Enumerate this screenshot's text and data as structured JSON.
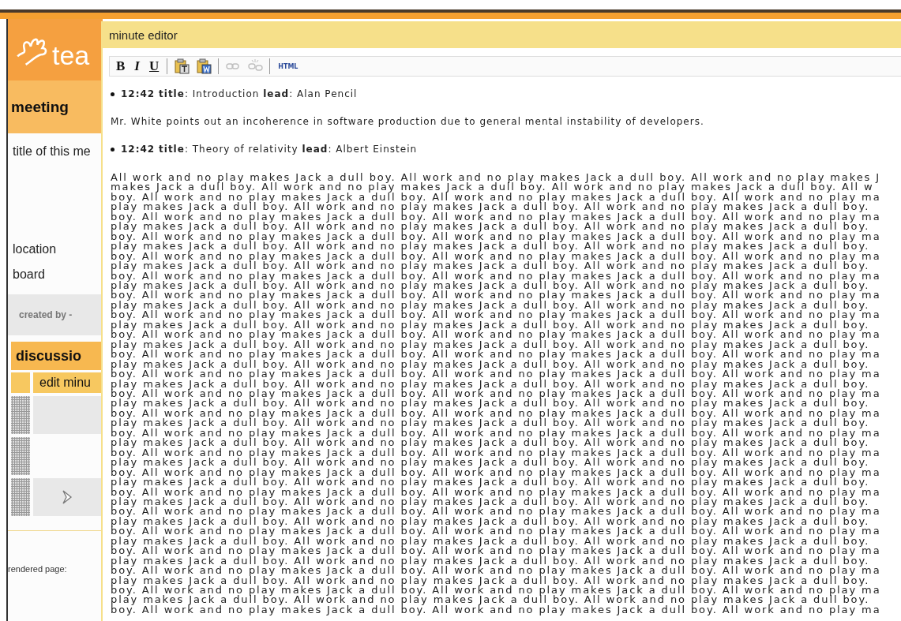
{
  "page": {
    "logo_text": "tea",
    "section_title": "meeting",
    "fields": [
      "title of this me",
      "location",
      "board"
    ],
    "created_by": "created by -",
    "discussion_title": "discussio",
    "column_header": "edit minu",
    "rows": [
      {
        "kind": "empty"
      },
      {
        "kind": "empty"
      },
      {
        "kind": "chevron"
      }
    ],
    "footer": "rendered page:"
  },
  "dialog": {
    "title": "minute editor",
    "toolbar": [
      {
        "kind": "bold",
        "label": "B",
        "disabled": false
      },
      {
        "kind": "italic",
        "label": "I",
        "disabled": false
      },
      {
        "kind": "underline",
        "label": "U",
        "disabled": false
      },
      {
        "kind": "separator"
      },
      {
        "kind": "paste-text",
        "disabled": false
      },
      {
        "kind": "paste-word",
        "disabled": false
      },
      {
        "kind": "separator"
      },
      {
        "kind": "link",
        "disabled": true
      },
      {
        "kind": "unlink",
        "disabled": true
      },
      {
        "kind": "separator"
      },
      {
        "kind": "html",
        "label": "HTML",
        "disabled": false
      }
    ],
    "entries": [
      {
        "kind": "item",
        "text": "**12:42** **title**: Introduction **lead**: Alan Pencil"
      },
      {
        "kind": "paragraph",
        "text": "Mr. White points out an incoherence in software production due to general mental instability of developers."
      },
      {
        "kind": "item",
        "text": "**12:42** **title**: Theory of relativity **lead**: Albert Einstein"
      }
    ],
    "body_lines": [
      "All work and no play makes Jack a dull boy. All work and no play makes Jack a dull boy. All work and no play makes J",
      "makes Jack a dull boy. All work and no play makes Jack a dull boy. All work and no play makes Jack a dull boy. All w",
      "boy. All work and no play makes Jack a dull boy. All work and no play makes Jack a dull boy. All work and no play ma",
      "play makes Jack a dull boy. All work and no play makes Jack a dull boy. All work and no play makes Jack a dull boy.",
      "boy. All work and no play makes Jack a dull boy. All work and no play makes Jack a dull boy. All work and no play ma",
      "play makes Jack a dull boy. All work and no play makes Jack a dull boy. All work and no play makes Jack a dull boy.",
      "boy. All work and no play makes Jack a dull boy. All work and no play makes Jack a dull boy. All work and no play ma",
      "play makes Jack a dull boy. All work and no play makes Jack a dull boy. All work and no play makes Jack a dull boy.",
      "boy. All work and no play makes Jack a dull boy. All work and no play makes Jack a dull boy. All work and no play ma",
      "play makes Jack a dull boy. All work and no play makes Jack a dull boy. All work and no play makes Jack a dull boy.",
      "boy. All work and no play makes Jack a dull boy. All work and no play makes Jack a dull boy. All work and no play ma",
      "play makes Jack a dull boy. All work and no play makes Jack a dull boy. All work and no play makes Jack a dull boy.",
      "boy. All work and no play makes Jack a dull boy. All work and no play makes Jack a dull boy. All work and no play ma",
      "play makes Jack a dull boy. All work and no play makes Jack a dull boy. All work and no play makes Jack a dull boy.",
      "boy. All work and no play makes Jack a dull boy. All work and no play makes Jack a dull boy. All work and no play ma",
      "play makes Jack a dull boy. All work and no play makes Jack a dull boy. All work and no play makes Jack a dull boy.",
      "boy. All work and no play makes Jack a dull boy. All work and no play makes Jack a dull boy. All work and no play ma",
      "play makes Jack a dull boy. All work and no play makes Jack a dull boy. All work and no play makes Jack a dull boy.",
      "boy. All work and no play makes Jack a dull boy. All work and no play makes Jack a dull boy. All work and no play ma",
      "play makes Jack a dull boy. All work and no play makes Jack a dull boy. All work and no play makes Jack a dull boy.",
      "boy. All work and no play makes Jack a dull boy. All work and no play makes Jack a dull boy. All work and no play ma",
      "play makes Jack a dull boy. All work and no play makes Jack a dull boy. All work and no play makes Jack a dull boy.",
      "boy. All work and no play makes Jack a dull boy. All work and no play makes Jack a dull boy. All work and no play ma",
      "play makes Jack a dull boy. All work and no play makes Jack a dull boy. All work and no play makes Jack a dull boy.",
      "boy. All work and no play makes Jack a dull boy. All work and no play makes Jack a dull boy. All work and no play ma",
      "play makes Jack a dull boy. All work and no play makes Jack a dull boy. All work and no play makes Jack a dull boy.",
      "boy. All work and no play makes Jack a dull boy. All work and no play makes Jack a dull boy. All work and no play ma",
      "play makes Jack a dull boy. All work and no play makes Jack a dull boy. All work and no play makes Jack a dull boy.",
      "boy. All work and no play makes Jack a dull boy. All work and no play makes Jack a dull boy. All work and no play ma",
      "play makes Jack a dull boy. All work and no play makes Jack a dull boy. All work and no play makes Jack a dull boy.",
      "boy. All work and no play makes Jack a dull boy. All work and no play makes Jack a dull boy. All work and no play ma",
      "play makes Jack a dull boy. All work and no play makes Jack a dull boy. All work and no play makes Jack a dull boy.",
      "boy. All work and no play makes Jack a dull boy. All work and no play makes Jack a dull boy. All work and no play ma",
      "play makes Jack a dull boy. All work and no play makes Jack a dull boy. All work and no play makes Jack a dull boy.",
      "boy. All work and no play makes Jack a dull boy. All work and no play makes Jack a dull boy. All work and no play ma",
      "play makes Jack a dull boy. All work and no play makes Jack a dull boy. All work and no play makes Jack a dull boy.",
      "boy. All work and no play makes Jack a dull boy. All work and no play makes Jack a dull boy. All work and no play ma",
      "play makes Jack a dull boy. All work and no play makes Jack a dull boy. All work and no play makes Jack a dull boy.",
      "boy. All work and no play makes Jack a dull boy. All work and no play makes Jack a dull boy. All work and no play ma",
      "play makes Jack a dull boy. All work and no play makes Jack a dull boy. All work and no play makes Jack a dull boy.",
      "boy. All work and no play makes Jack a dull boy. All work and no play makes Jack a dull boy. All work and no play ma",
      "play makes Jack a dull boy. All work and no play makes Jack a dull boy. All work and no play makes Jack a dull boy.",
      "boy. All work and no play makes Jack a dull boy. All work and no play makes Jack a dull boy. All work and no play ma",
      "play makes Jack a dull boy. All work and no play makes Jack a dull boy. All work and no play makes Jack a dull boy.",
      "boy. All work and no play makes Jack a dull boy. All work and no play makes Jack a dull boy. All work and no play ma"
    ]
  }
}
